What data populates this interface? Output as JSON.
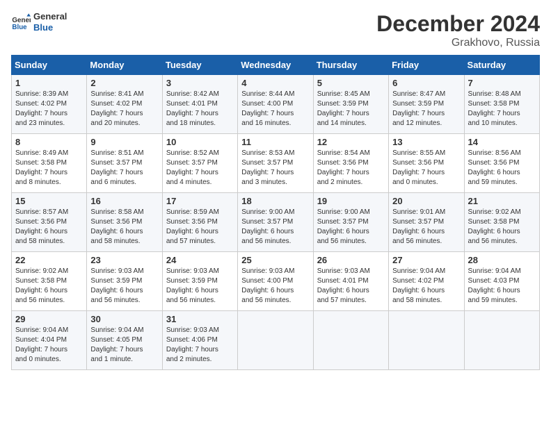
{
  "logo": {
    "text_general": "General",
    "text_blue": "Blue"
  },
  "title": "December 2024",
  "location": "Grakhovo, Russia",
  "days_of_week": [
    "Sunday",
    "Monday",
    "Tuesday",
    "Wednesday",
    "Thursday",
    "Friday",
    "Saturday"
  ],
  "weeks": [
    [
      {
        "day": "1",
        "content": "Sunrise: 8:39 AM\nSunset: 4:02 PM\nDaylight: 7 hours\nand 23 minutes."
      },
      {
        "day": "2",
        "content": "Sunrise: 8:41 AM\nSunset: 4:02 PM\nDaylight: 7 hours\nand 20 minutes."
      },
      {
        "day": "3",
        "content": "Sunrise: 8:42 AM\nSunset: 4:01 PM\nDaylight: 7 hours\nand 18 minutes."
      },
      {
        "day": "4",
        "content": "Sunrise: 8:44 AM\nSunset: 4:00 PM\nDaylight: 7 hours\nand 16 minutes."
      },
      {
        "day": "5",
        "content": "Sunrise: 8:45 AM\nSunset: 3:59 PM\nDaylight: 7 hours\nand 14 minutes."
      },
      {
        "day": "6",
        "content": "Sunrise: 8:47 AM\nSunset: 3:59 PM\nDaylight: 7 hours\nand 12 minutes."
      },
      {
        "day": "7",
        "content": "Sunrise: 8:48 AM\nSunset: 3:58 PM\nDaylight: 7 hours\nand 10 minutes."
      }
    ],
    [
      {
        "day": "8",
        "content": "Sunrise: 8:49 AM\nSunset: 3:58 PM\nDaylight: 7 hours\nand 8 minutes."
      },
      {
        "day": "9",
        "content": "Sunrise: 8:51 AM\nSunset: 3:57 PM\nDaylight: 7 hours\nand 6 minutes."
      },
      {
        "day": "10",
        "content": "Sunrise: 8:52 AM\nSunset: 3:57 PM\nDaylight: 7 hours\nand 4 minutes."
      },
      {
        "day": "11",
        "content": "Sunrise: 8:53 AM\nSunset: 3:57 PM\nDaylight: 7 hours\nand 3 minutes."
      },
      {
        "day": "12",
        "content": "Sunrise: 8:54 AM\nSunset: 3:56 PM\nDaylight: 7 hours\nand 2 minutes."
      },
      {
        "day": "13",
        "content": "Sunrise: 8:55 AM\nSunset: 3:56 PM\nDaylight: 7 hours\nand 0 minutes."
      },
      {
        "day": "14",
        "content": "Sunrise: 8:56 AM\nSunset: 3:56 PM\nDaylight: 6 hours\nand 59 minutes."
      }
    ],
    [
      {
        "day": "15",
        "content": "Sunrise: 8:57 AM\nSunset: 3:56 PM\nDaylight: 6 hours\nand 58 minutes."
      },
      {
        "day": "16",
        "content": "Sunrise: 8:58 AM\nSunset: 3:56 PM\nDaylight: 6 hours\nand 58 minutes."
      },
      {
        "day": "17",
        "content": "Sunrise: 8:59 AM\nSunset: 3:56 PM\nDaylight: 6 hours\nand 57 minutes."
      },
      {
        "day": "18",
        "content": "Sunrise: 9:00 AM\nSunset: 3:57 PM\nDaylight: 6 hours\nand 56 minutes."
      },
      {
        "day": "19",
        "content": "Sunrise: 9:00 AM\nSunset: 3:57 PM\nDaylight: 6 hours\nand 56 minutes."
      },
      {
        "day": "20",
        "content": "Sunrise: 9:01 AM\nSunset: 3:57 PM\nDaylight: 6 hours\nand 56 minutes."
      },
      {
        "day": "21",
        "content": "Sunrise: 9:02 AM\nSunset: 3:58 PM\nDaylight: 6 hours\nand 56 minutes."
      }
    ],
    [
      {
        "day": "22",
        "content": "Sunrise: 9:02 AM\nSunset: 3:58 PM\nDaylight: 6 hours\nand 56 minutes."
      },
      {
        "day": "23",
        "content": "Sunrise: 9:03 AM\nSunset: 3:59 PM\nDaylight: 6 hours\nand 56 minutes."
      },
      {
        "day": "24",
        "content": "Sunrise: 9:03 AM\nSunset: 3:59 PM\nDaylight: 6 hours\nand 56 minutes."
      },
      {
        "day": "25",
        "content": "Sunrise: 9:03 AM\nSunset: 4:00 PM\nDaylight: 6 hours\nand 56 minutes."
      },
      {
        "day": "26",
        "content": "Sunrise: 9:03 AM\nSunset: 4:01 PM\nDaylight: 6 hours\nand 57 minutes."
      },
      {
        "day": "27",
        "content": "Sunrise: 9:04 AM\nSunset: 4:02 PM\nDaylight: 6 hours\nand 58 minutes."
      },
      {
        "day": "28",
        "content": "Sunrise: 9:04 AM\nSunset: 4:03 PM\nDaylight: 6 hours\nand 59 minutes."
      }
    ],
    [
      {
        "day": "29",
        "content": "Sunrise: 9:04 AM\nSunset: 4:04 PM\nDaylight: 7 hours\nand 0 minutes."
      },
      {
        "day": "30",
        "content": "Sunrise: 9:04 AM\nSunset: 4:05 PM\nDaylight: 7 hours\nand 1 minute."
      },
      {
        "day": "31",
        "content": "Sunrise: 9:03 AM\nSunset: 4:06 PM\nDaylight: 7 hours\nand 2 minutes."
      },
      {
        "day": "",
        "content": ""
      },
      {
        "day": "",
        "content": ""
      },
      {
        "day": "",
        "content": ""
      },
      {
        "day": "",
        "content": ""
      }
    ]
  ]
}
